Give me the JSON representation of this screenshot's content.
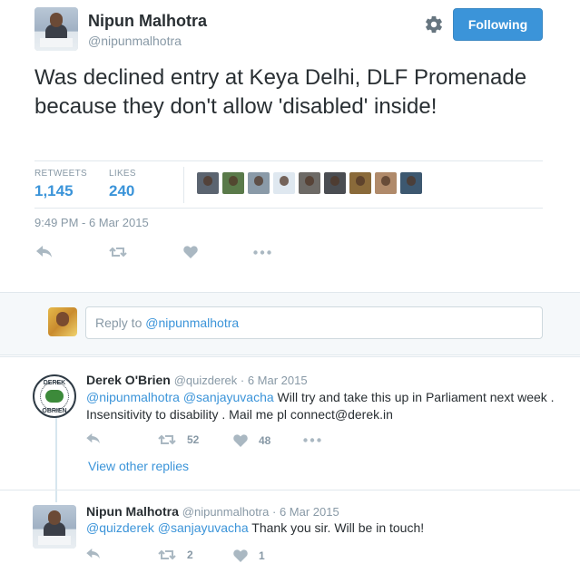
{
  "tweet": {
    "author_name": "Nipun Malhotra",
    "author_handle": "@nipunmalhotra",
    "follow_label": "Following",
    "text": "Was declined entry at Keya Delhi, DLF Promenade because they don't allow 'disabled' inside!",
    "retweets_label": "RETWEETS",
    "retweets_count": "1,145",
    "likes_label": "LIKES",
    "likes_count": "240",
    "timestamp": "9:49 PM - 6 Mar 2015",
    "liker_colors": [
      "#5b6470",
      "#5a7a4a",
      "#8a9aa8",
      "#dfe8f0",
      "#6d6a66",
      "#4a4d52",
      "#8a6a3a",
      "#b08a6a",
      "#3d5870"
    ]
  },
  "reply_box": {
    "placeholder_prefix": "Reply to ",
    "placeholder_mention": "@nipunmalhotra"
  },
  "replies": [
    {
      "name": "Derek O'Brien",
      "handle": "@quizderek",
      "date": "6 Mar 2015",
      "mentions": "@nipunmalhotra @sanjayuvacha",
      "text": " Will try and take this up in Parliament next week . Insensitivity to disability . Mail me  pl connect@derek.in",
      "retweet_count": "52",
      "like_count": "48",
      "avatar_letters_top": "DEREK",
      "avatar_letters_bottom": "OBRIEN"
    },
    {
      "name": "Nipun Malhotra",
      "handle": "@nipunmalhotra",
      "date": "6 Mar 2015",
      "mentions": "@quizderek @sanjayuvacha",
      "text": " Thank you sir. Will be in touch!",
      "retweet_count": "2",
      "like_count": "1"
    }
  ],
  "view_other_replies": "View other replies",
  "separator": " · ",
  "icons": {
    "reply": "reply-icon",
    "retweet": "retweet-icon",
    "like": "heart-icon",
    "more": "more-icon",
    "settings": "gear-icon"
  },
  "colors": {
    "accent": "#3b94d9",
    "muted": "#8899a6",
    "icon": "#aab8c2"
  }
}
